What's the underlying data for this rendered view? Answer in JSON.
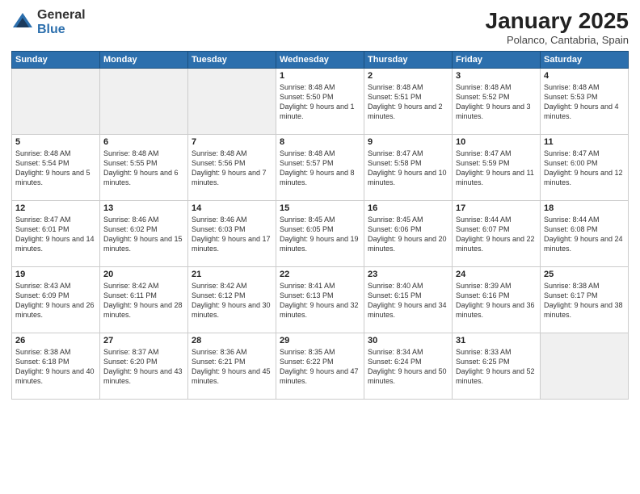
{
  "header": {
    "logo_general": "General",
    "logo_blue": "Blue",
    "title": "January 2025",
    "subtitle": "Polanco, Cantabria, Spain"
  },
  "days_of_week": [
    "Sunday",
    "Monday",
    "Tuesday",
    "Wednesday",
    "Thursday",
    "Friday",
    "Saturday"
  ],
  "weeks": [
    [
      {
        "day": "",
        "info": ""
      },
      {
        "day": "",
        "info": ""
      },
      {
        "day": "",
        "info": ""
      },
      {
        "day": "1",
        "info": "Sunrise: 8:48 AM\nSunset: 5:50 PM\nDaylight: 9 hours\nand 1 minute."
      },
      {
        "day": "2",
        "info": "Sunrise: 8:48 AM\nSunset: 5:51 PM\nDaylight: 9 hours\nand 2 minutes."
      },
      {
        "day": "3",
        "info": "Sunrise: 8:48 AM\nSunset: 5:52 PM\nDaylight: 9 hours\nand 3 minutes."
      },
      {
        "day": "4",
        "info": "Sunrise: 8:48 AM\nSunset: 5:53 PM\nDaylight: 9 hours\nand 4 minutes."
      }
    ],
    [
      {
        "day": "5",
        "info": "Sunrise: 8:48 AM\nSunset: 5:54 PM\nDaylight: 9 hours\nand 5 minutes."
      },
      {
        "day": "6",
        "info": "Sunrise: 8:48 AM\nSunset: 5:55 PM\nDaylight: 9 hours\nand 6 minutes."
      },
      {
        "day": "7",
        "info": "Sunrise: 8:48 AM\nSunset: 5:56 PM\nDaylight: 9 hours\nand 7 minutes."
      },
      {
        "day": "8",
        "info": "Sunrise: 8:48 AM\nSunset: 5:57 PM\nDaylight: 9 hours\nand 8 minutes."
      },
      {
        "day": "9",
        "info": "Sunrise: 8:47 AM\nSunset: 5:58 PM\nDaylight: 9 hours\nand 10 minutes."
      },
      {
        "day": "10",
        "info": "Sunrise: 8:47 AM\nSunset: 5:59 PM\nDaylight: 9 hours\nand 11 minutes."
      },
      {
        "day": "11",
        "info": "Sunrise: 8:47 AM\nSunset: 6:00 PM\nDaylight: 9 hours\nand 12 minutes."
      }
    ],
    [
      {
        "day": "12",
        "info": "Sunrise: 8:47 AM\nSunset: 6:01 PM\nDaylight: 9 hours\nand 14 minutes."
      },
      {
        "day": "13",
        "info": "Sunrise: 8:46 AM\nSunset: 6:02 PM\nDaylight: 9 hours\nand 15 minutes."
      },
      {
        "day": "14",
        "info": "Sunrise: 8:46 AM\nSunset: 6:03 PM\nDaylight: 9 hours\nand 17 minutes."
      },
      {
        "day": "15",
        "info": "Sunrise: 8:45 AM\nSunset: 6:05 PM\nDaylight: 9 hours\nand 19 minutes."
      },
      {
        "day": "16",
        "info": "Sunrise: 8:45 AM\nSunset: 6:06 PM\nDaylight: 9 hours\nand 20 minutes."
      },
      {
        "day": "17",
        "info": "Sunrise: 8:44 AM\nSunset: 6:07 PM\nDaylight: 9 hours\nand 22 minutes."
      },
      {
        "day": "18",
        "info": "Sunrise: 8:44 AM\nSunset: 6:08 PM\nDaylight: 9 hours\nand 24 minutes."
      }
    ],
    [
      {
        "day": "19",
        "info": "Sunrise: 8:43 AM\nSunset: 6:09 PM\nDaylight: 9 hours\nand 26 minutes."
      },
      {
        "day": "20",
        "info": "Sunrise: 8:42 AM\nSunset: 6:11 PM\nDaylight: 9 hours\nand 28 minutes."
      },
      {
        "day": "21",
        "info": "Sunrise: 8:42 AM\nSunset: 6:12 PM\nDaylight: 9 hours\nand 30 minutes."
      },
      {
        "day": "22",
        "info": "Sunrise: 8:41 AM\nSunset: 6:13 PM\nDaylight: 9 hours\nand 32 minutes."
      },
      {
        "day": "23",
        "info": "Sunrise: 8:40 AM\nSunset: 6:15 PM\nDaylight: 9 hours\nand 34 minutes."
      },
      {
        "day": "24",
        "info": "Sunrise: 8:39 AM\nSunset: 6:16 PM\nDaylight: 9 hours\nand 36 minutes."
      },
      {
        "day": "25",
        "info": "Sunrise: 8:38 AM\nSunset: 6:17 PM\nDaylight: 9 hours\nand 38 minutes."
      }
    ],
    [
      {
        "day": "26",
        "info": "Sunrise: 8:38 AM\nSunset: 6:18 PM\nDaylight: 9 hours\nand 40 minutes."
      },
      {
        "day": "27",
        "info": "Sunrise: 8:37 AM\nSunset: 6:20 PM\nDaylight: 9 hours\nand 43 minutes."
      },
      {
        "day": "28",
        "info": "Sunrise: 8:36 AM\nSunset: 6:21 PM\nDaylight: 9 hours\nand 45 minutes."
      },
      {
        "day": "29",
        "info": "Sunrise: 8:35 AM\nSunset: 6:22 PM\nDaylight: 9 hours\nand 47 minutes."
      },
      {
        "day": "30",
        "info": "Sunrise: 8:34 AM\nSunset: 6:24 PM\nDaylight: 9 hours\nand 50 minutes."
      },
      {
        "day": "31",
        "info": "Sunrise: 8:33 AM\nSunset: 6:25 PM\nDaylight: 9 hours\nand 52 minutes."
      },
      {
        "day": "",
        "info": ""
      }
    ]
  ]
}
